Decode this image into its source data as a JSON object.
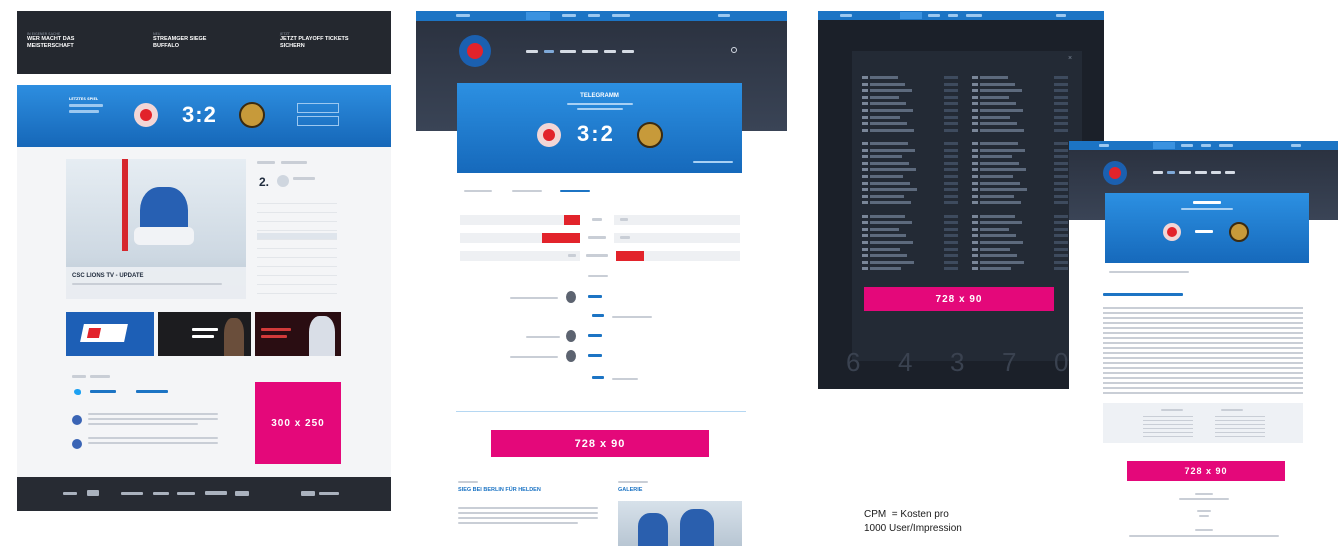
{
  "panel1": {
    "topbar_items": [
      {
        "kicker": "IN EIGENER SACHE",
        "title": "WER MACHT DAS MEISTERSCHAFT"
      },
      {
        "kicker": "NEU",
        "title": "STREAMGER SIEGE BUFFALO"
      },
      {
        "kicker": "JETZT",
        "title": "JETZT PLAYOFF TICKETS SICHERN"
      }
    ],
    "hero_label": "LETZTES SPIEL",
    "score_home": "3",
    "score_sep": ":",
    "score_away": "2",
    "video_caption": "CSC LIONS TV - UPDATE",
    "rank": "2.",
    "ad_label": "300 x 250"
  },
  "panel2": {
    "hero_title": "TELEGRAMM",
    "score_home": "3",
    "score_sep": ":",
    "score_away": "2",
    "ad_label": "728 x 90",
    "article_title": "SIEG BEI BERLIN FÜR HELDEN",
    "gallery_title": "GALERIE"
  },
  "panel3": {
    "ad_label": "728 x 90",
    "footer_numbers": [
      "6",
      "4",
      "3",
      "7",
      "0"
    ]
  },
  "panel4": {
    "ad_label": "728 x 90"
  },
  "caption": {
    "line1": "CPM  = Kosten pro",
    "line2": "1000 User/Impression"
  },
  "colors": {
    "brand_blue": "#1c74c4",
    "ad_pink": "#e4087a",
    "dark_header": "#22262d",
    "roster_bg": "#1f2530"
  }
}
